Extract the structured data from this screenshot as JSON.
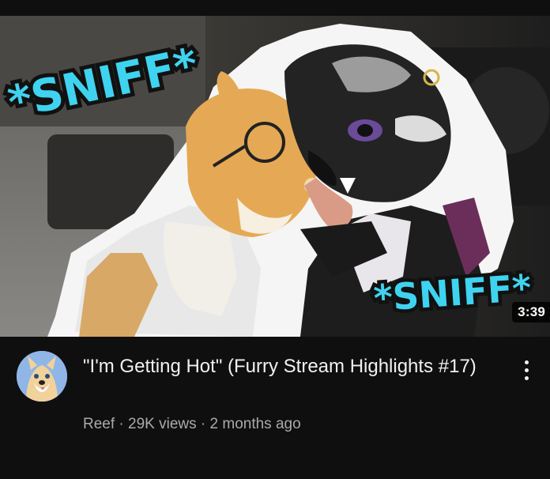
{
  "thumbnail": {
    "caption_top": "*SNIFF*",
    "caption_bottom": "*SNIFF*",
    "duration": "3:39"
  },
  "video": {
    "title": "\"I'm Getting Hot\" (Furry Stream Highlights #17)",
    "channel": "Reef",
    "separator_1": " · ",
    "views": "29K views",
    "separator_2": " · ",
    "age": "2 months ago"
  },
  "colors": {
    "background": "#0f0f0f",
    "title_text": "#f1f1f1",
    "secondary_text": "#aaaaaa",
    "caption_fill": "#3fd3f0",
    "caption_outline": "#111111"
  }
}
